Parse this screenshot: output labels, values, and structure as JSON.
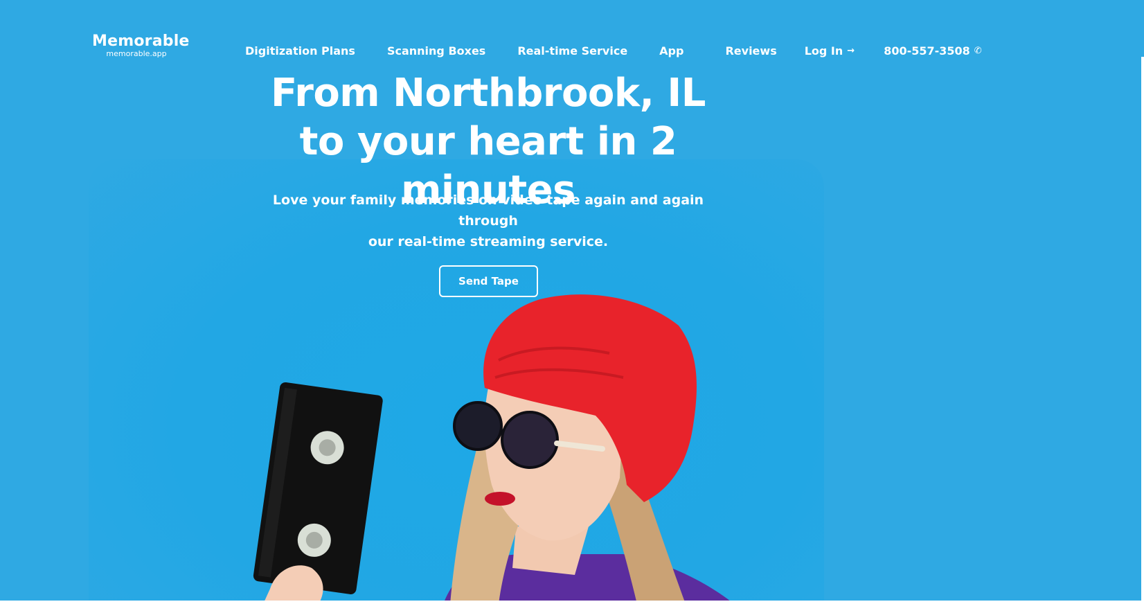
{
  "brand": {
    "name": "Memorable",
    "domain": "memorable.app"
  },
  "nav": {
    "items": [
      {
        "label": "Digitization Plans"
      },
      {
        "label": "Scanning Boxes"
      },
      {
        "label": "Real-time Service"
      },
      {
        "label": "App"
      },
      {
        "label": "Reviews"
      },
      {
        "label": "Log In",
        "icon": "arrow-right-icon"
      },
      {
        "label": "800-557-3508",
        "icon": "phone-icon"
      }
    ]
  },
  "hero": {
    "title_line1": "From Northbrook, IL",
    "title_line2": "to your heart in 2 minutes",
    "subtitle_line1": "Love your family memories on video tape again and again through",
    "subtitle_line2": "our real-time streaming service.",
    "cta_label": "Send Tape"
  },
  "colors": {
    "background": "#2fa9e3",
    "text": "#ffffff",
    "hat": "#e8232b",
    "tape": "#111111"
  }
}
